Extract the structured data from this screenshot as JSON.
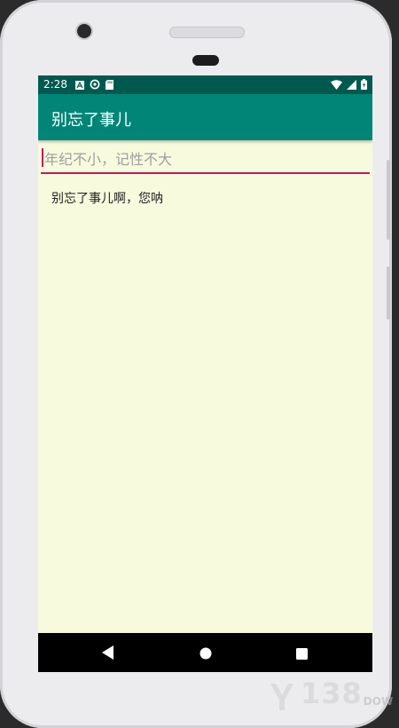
{
  "status_bar": {
    "time": "2:28",
    "left_icons": [
      "a-icon",
      "sync-icon",
      "sd-card-icon"
    ],
    "right_icons": [
      "wifi-icon",
      "signal-icon",
      "battery-icon"
    ]
  },
  "app_bar": {
    "title": "别忘了事儿"
  },
  "editor": {
    "placeholder": "年纪不小，记性不大",
    "value": ""
  },
  "note": {
    "text": "别忘了事儿啊，您呐"
  },
  "nav_bar": {
    "buttons": [
      "back-icon",
      "home-icon",
      "recents-icon"
    ]
  },
  "watermark": {
    "text": "138",
    "sub": "DOW"
  },
  "colors": {
    "status_bar": "#00594f",
    "app_bar": "#008577",
    "background": "#f8fadd",
    "accent": "#c2185b"
  }
}
